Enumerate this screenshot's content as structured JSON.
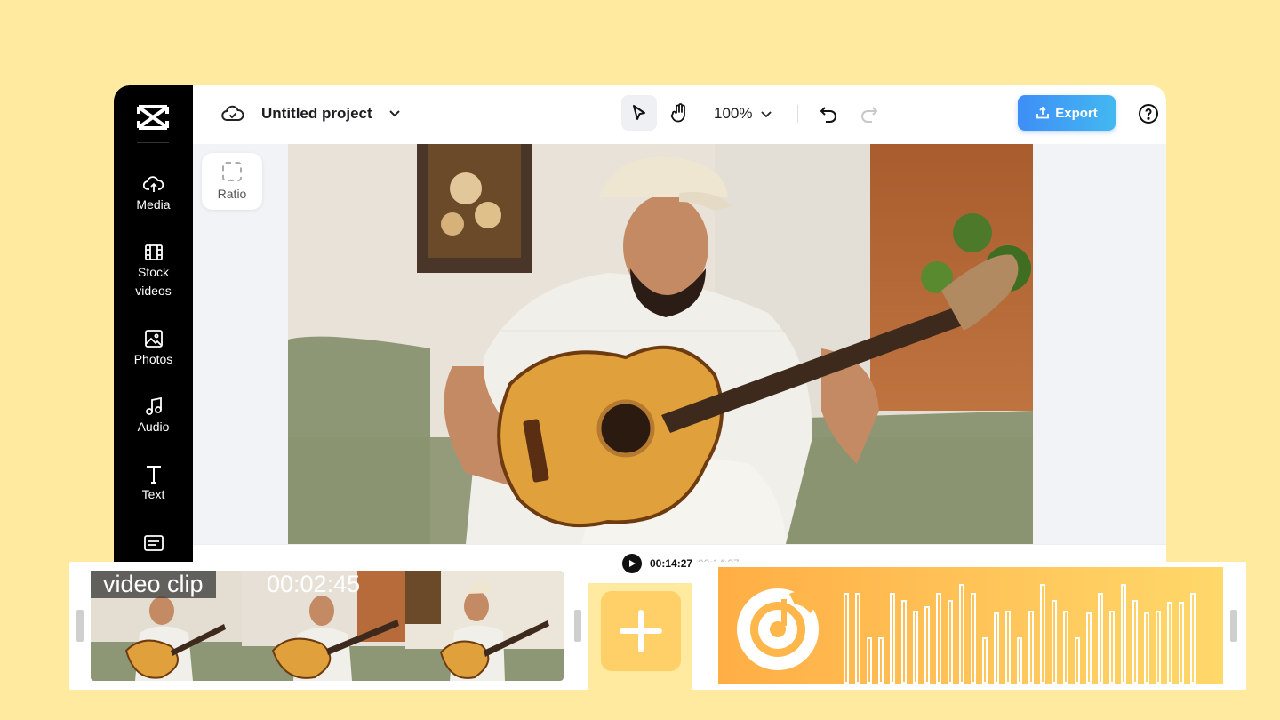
{
  "project": {
    "title": "Untitled project"
  },
  "toolbar": {
    "zoom": "100%",
    "export_label": "Export"
  },
  "sidebar": {
    "items": [
      {
        "label": "Media",
        "icon": "cloud-upload-icon"
      },
      {
        "label": "Stock\nvideos",
        "icon": "film-icon"
      },
      {
        "label": "Photos",
        "icon": "image-icon"
      },
      {
        "label": "Audio",
        "icon": "music-note-icon"
      },
      {
        "label": "Text",
        "icon": "text-icon"
      },
      {
        "label": "",
        "icon": "captions-icon"
      }
    ]
  },
  "canvas": {
    "ratio_label": "Ratio"
  },
  "timeline": {
    "current_time": "00:14:27",
    "total_time": "00:14:27"
  },
  "video_card": {
    "label": "video clip",
    "duration": "00:02:45"
  },
  "colors": {
    "background": "#ffeaa0",
    "accent": "#3e8ef7",
    "audio": "#ffae45"
  }
}
